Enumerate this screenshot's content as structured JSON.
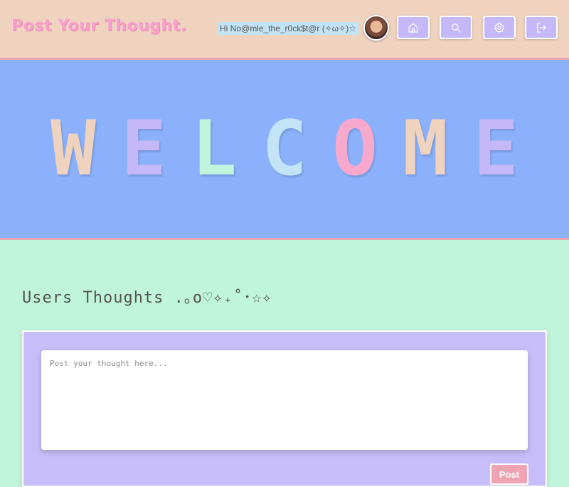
{
  "header": {
    "logo": "Post Your Thought.",
    "greeting": "Hi No@mle_the_r0ck$t@r (✧ω✧)☆",
    "nav": [
      {
        "name": "home-icon"
      },
      {
        "name": "search-icon"
      },
      {
        "name": "gear-icon"
      },
      {
        "name": "logout-icon"
      }
    ]
  },
  "banner": {
    "letters": [
      "W",
      "E",
      "L",
      "C",
      "O",
      "M",
      "E"
    ],
    "colors": [
      "#efd3bf",
      "#c4b8f8",
      "#c0f5dc",
      "#c2e4f6",
      "#f7a9cd",
      "#efd3bf",
      "#c4b8f8"
    ]
  },
  "main": {
    "title": "Users Thoughts .｡o♡✧₊˚･☆✧",
    "post": {
      "placeholder": "Post your thought here...",
      "button_label": "Post"
    }
  }
}
